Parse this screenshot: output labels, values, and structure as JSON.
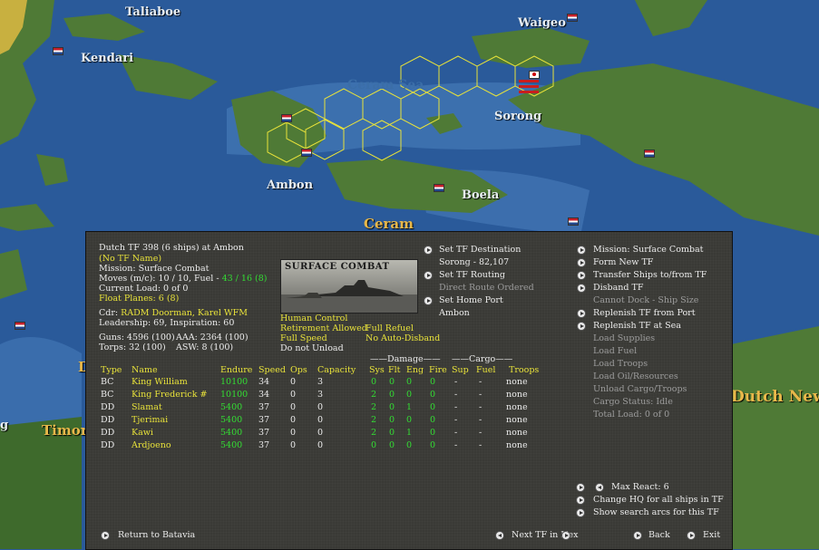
{
  "map": {
    "labels": {
      "taliaboe": "Taliaboe",
      "waigeo": "Waigeo",
      "kendari": "Kendari",
      "ceram_sea": "Ceram Sea",
      "sorong": "Sorong",
      "ambon": "Ambon",
      "boela": "Boela",
      "ceram": "Ceram",
      "timor": "Timor",
      "dutch_new": "Dutch New",
      "d": "D",
      "g": "g"
    }
  },
  "tf": {
    "header": "Dutch TF 398 (6 ships) at Ambon",
    "name": "(No TF Name)",
    "mission": "Mission: Surface Combat",
    "moves_prefix": "Moves (m/c): 10 / 10, Fuel - ",
    "fuel": "43 / 16 (8)",
    "current_load": "Current Load: 0 of 0",
    "float_planes": "Float Planes: 6 (8)",
    "cdr_prefix": "Cdr:",
    "cdr_name": "RADM Doorman, Karel WFM",
    "leadership": "Leadership: 69, Inspiration: 60",
    "guns": "Guns: 4596 (100)",
    "aaa": "AAA: 2364 (100)",
    "torps": "Torps: 32 (100)",
    "asw": "ASW: 8 (100)"
  },
  "photo_caption": "SURFACE COMBAT",
  "settings": {
    "human_control": "Human Control",
    "retirement": "Retirement Allowed",
    "full_speed": "Full Speed",
    "do_not_unload": "Do not Unload",
    "full_refuel": "Full Refuel",
    "no_auto_disband": "No Auto-Disband"
  },
  "middle_actions": {
    "set_dest": "Set TF Destination",
    "dest_value": "Sorong - 82,107",
    "set_routing": "Set TF Routing",
    "routing_value": "Direct Route Ordered",
    "set_home": "Set Home Port",
    "home_value": "Ambon"
  },
  "right_actions": {
    "mission": "Mission: Surface Combat",
    "form_new": "Form New TF",
    "transfer": "Transfer Ships to/from TF",
    "disband": "Disband TF",
    "cannot_dock": "Cannot Dock - Ship Size",
    "replenish_port": "Replenish TF from Port",
    "replenish_sea": "Replenish TF at Sea",
    "load_supplies": "Load Supplies",
    "load_fuel": "Load Fuel",
    "load_troops": "Load Troops",
    "load_oil": "Load Oil/Resources",
    "unload": "Unload Cargo/Troops",
    "cargo_status": "Cargo Status: Idle",
    "total_load": "Total Load: 0 of 0"
  },
  "table": {
    "group_damage": "——Damage——",
    "group_cargo": "——Cargo——",
    "headers": {
      "type": "Type",
      "name": "Name",
      "endure": "Endure",
      "speed": "Speed",
      "ops": "Ops",
      "capacity": "Capacity",
      "sys": "Sys",
      "flt": "Flt",
      "eng": "Eng",
      "fire": "Fire",
      "sup": "Sup",
      "fuel": "Fuel",
      "troops": "Troops"
    },
    "rows": [
      {
        "type": "BC",
        "name": "King William",
        "endure": "10100",
        "speed": "34",
        "ops": "0",
        "capacity": "3",
        "sys": "0",
        "flt": "0",
        "eng": "0",
        "fire": "0",
        "sup": "-",
        "fuel": "-",
        "troops": "none"
      },
      {
        "type": "BC",
        "name": "King Frederick #",
        "endure": "10100",
        "speed": "34",
        "ops": "0",
        "capacity": "3",
        "sys": "2",
        "flt": "0",
        "eng": "0",
        "fire": "0",
        "sup": "-",
        "fuel": "-",
        "troops": "none"
      },
      {
        "type": "DD",
        "name": "Slamat",
        "endure": "5400",
        "speed": "37",
        "ops": "0",
        "capacity": "0",
        "sys": "2",
        "flt": "0",
        "eng": "1",
        "fire": "0",
        "sup": "-",
        "fuel": "-",
        "troops": "none"
      },
      {
        "type": "DD",
        "name": "Tjerimai",
        "endure": "5400",
        "speed": "37",
        "ops": "0",
        "capacity": "0",
        "sys": "2",
        "flt": "0",
        "eng": "0",
        "fire": "0",
        "sup": "-",
        "fuel": "-",
        "troops": "none"
      },
      {
        "type": "DD",
        "name": "Kawi",
        "endure": "5400",
        "speed": "37",
        "ops": "0",
        "capacity": "0",
        "sys": "2",
        "flt": "0",
        "eng": "1",
        "fire": "0",
        "sup": "-",
        "fuel": "-",
        "troops": "none"
      },
      {
        "type": "DD",
        "name": "Ardjoeno",
        "endure": "5400",
        "speed": "37",
        "ops": "0",
        "capacity": "0",
        "sys": "0",
        "flt": "0",
        "eng": "0",
        "fire": "0",
        "sup": "-",
        "fuel": "-",
        "troops": "none"
      }
    ]
  },
  "bottom": {
    "max_react": "Max React: 6",
    "change_hq": "Change HQ for all ships in TF",
    "show_search": "Show search arcs for this TF",
    "return": "Return to Batavia",
    "next_tf": "Next TF in Hex",
    "back": "Back",
    "exit": "Exit"
  },
  "colors": {
    "ocean": "#2a5a9a",
    "land": "#4f7a36",
    "panel_bg": "#3a3a36",
    "highlight_yellow": "#e8e23a",
    "value_green": "#33dd33",
    "disabled_gray": "#9c9c9c"
  }
}
